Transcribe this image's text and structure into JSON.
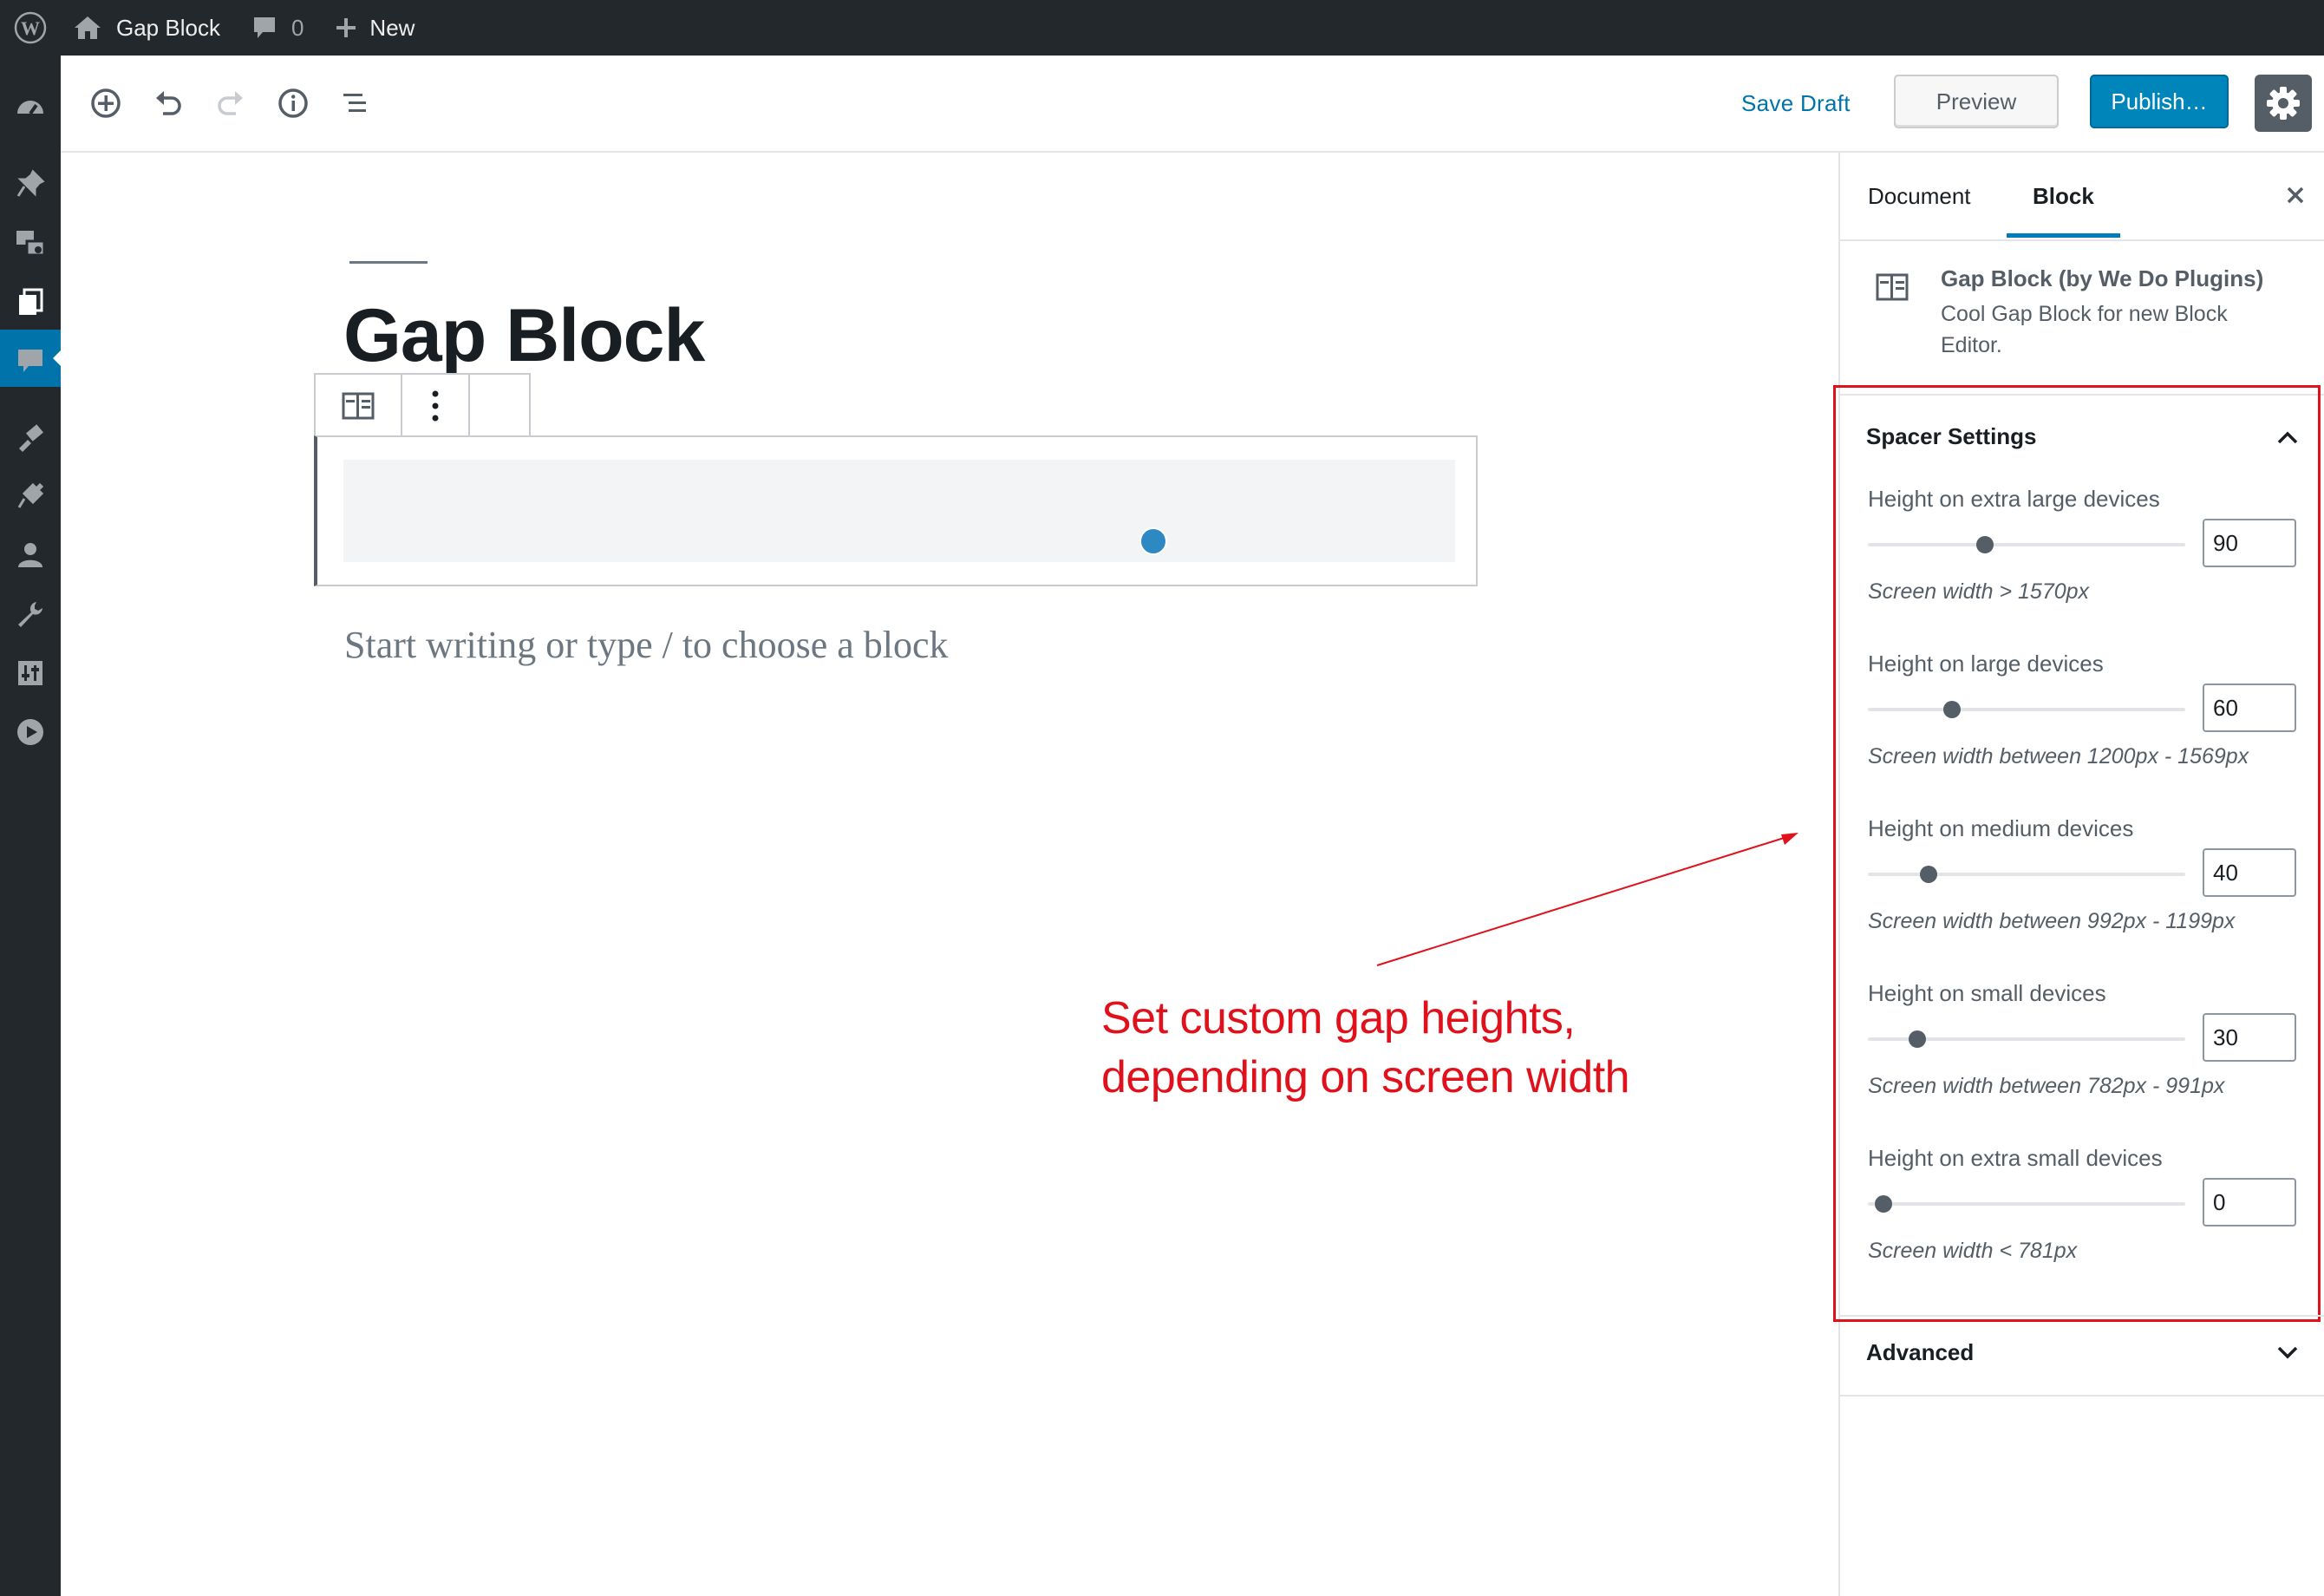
{
  "admin_bar": {
    "site_name": "Gap Block",
    "comments_count": "0",
    "new_label": "New"
  },
  "admin_menu": {
    "items": [
      "dashboard-icon",
      "posts-icon",
      "media-icon",
      "pages-icon",
      "comments-icon",
      "appearance-icon",
      "plugins-icon",
      "users-icon",
      "tools-icon",
      "settings-icon",
      "media-player-icon"
    ],
    "active_item": "pages-icon",
    "active_color": "#0073aa"
  },
  "header": {
    "save_draft_label": "Save Draft",
    "preview_label": "Preview",
    "publish_label": "Publish…"
  },
  "post": {
    "title": "Gap Block",
    "appender_placeholder": "Start writing or type / to choose a block"
  },
  "annotation": {
    "line1": "Set custom gap heights,",
    "line2": "depending on screen width",
    "color": "#e0111b"
  },
  "sidebar": {
    "tabs": [
      {
        "label": "Document",
        "active": false
      },
      {
        "label": "Block",
        "active": true
      }
    ],
    "block_card": {
      "title": "Gap Block (by We Do Plugins)",
      "description": "Cool Gap Block for new Block Editor."
    },
    "spacer_panel": {
      "title": "Spacer Settings",
      "expanded": true,
      "controls": [
        {
          "label": "Height on extra large devices",
          "value": "90",
          "help": "Screen width > 1570px",
          "slider_fraction": 0.37
        },
        {
          "label": "Height on large devices",
          "value": "60",
          "help": "Screen width between 1200px - 1569px",
          "slider_fraction": 0.265
        },
        {
          "label": "Height on medium devices",
          "value": "40",
          "help": "Screen width between 992px - 1199px",
          "slider_fraction": 0.19
        },
        {
          "label": "Height on small devices",
          "value": "30",
          "help": "Screen width between 782px - 991px",
          "slider_fraction": 0.155
        },
        {
          "label": "Height on extra small devices",
          "value": "0",
          "help": "Screen width < 781px",
          "slider_fraction": 0.05
        }
      ]
    },
    "advanced_panel": {
      "title": "Advanced",
      "expanded": false
    }
  },
  "colors": {
    "admin_dark": "#23282d",
    "accent_blue": "#0073aa",
    "publish_blue": "#0085ba",
    "spacer_handle": "#2e89c3"
  }
}
